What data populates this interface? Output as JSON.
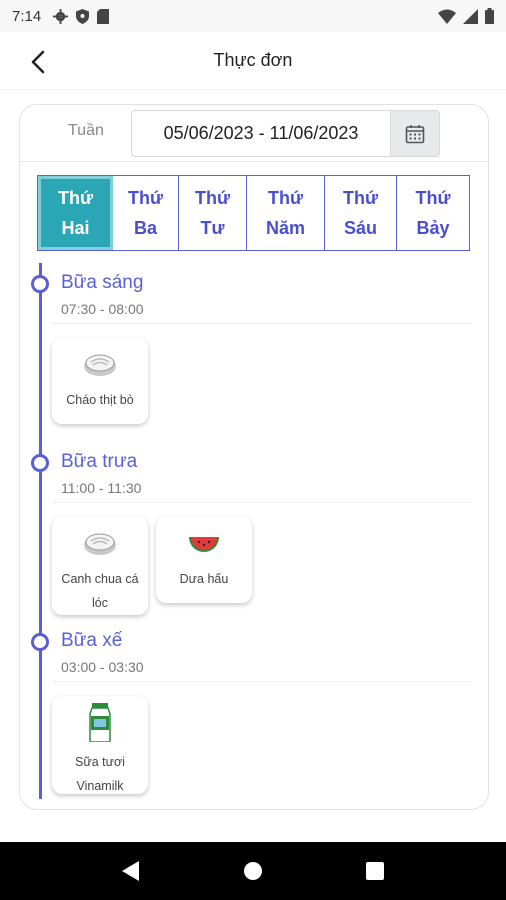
{
  "status_bar": {
    "time": "7:14"
  },
  "header": {
    "title": "Thực đơn"
  },
  "week": {
    "label": "Tuần",
    "range": "05/06/2023 - 11/06/2023"
  },
  "days": [
    {
      "label": "Thứ\nHai",
      "active": true
    },
    {
      "label": "Thứ\nBa",
      "active": false
    },
    {
      "label": "Thứ\nTư",
      "active": false
    },
    {
      "label": "Thứ\nNăm",
      "active": false
    },
    {
      "label": "Thứ\nSáu",
      "active": false
    },
    {
      "label": "Thứ\nBảy",
      "active": false
    }
  ],
  "meals": [
    {
      "name": "Bữa sáng",
      "time": "07:30 - 08:00",
      "items": [
        {
          "name": "Cháo thịt bò",
          "icon": "porridge-icon"
        }
      ]
    },
    {
      "name": "Bữa trưa",
      "time": "11:00 - 11:30",
      "items": [
        {
          "name": "Canh chua cá lóc",
          "icon": "soup-icon"
        },
        {
          "name": "Dưa hấu",
          "icon": "watermelon-icon"
        }
      ]
    },
    {
      "name": "Bữa xế",
      "time": "03:00 - 03:30",
      "items": [
        {
          "name": "Sữa tươi Vinamilk",
          "icon": "milk-carton-icon"
        }
      ]
    }
  ],
  "colors": {
    "accent": "#5b5fd6",
    "active_tab": "#2aa6b4"
  }
}
